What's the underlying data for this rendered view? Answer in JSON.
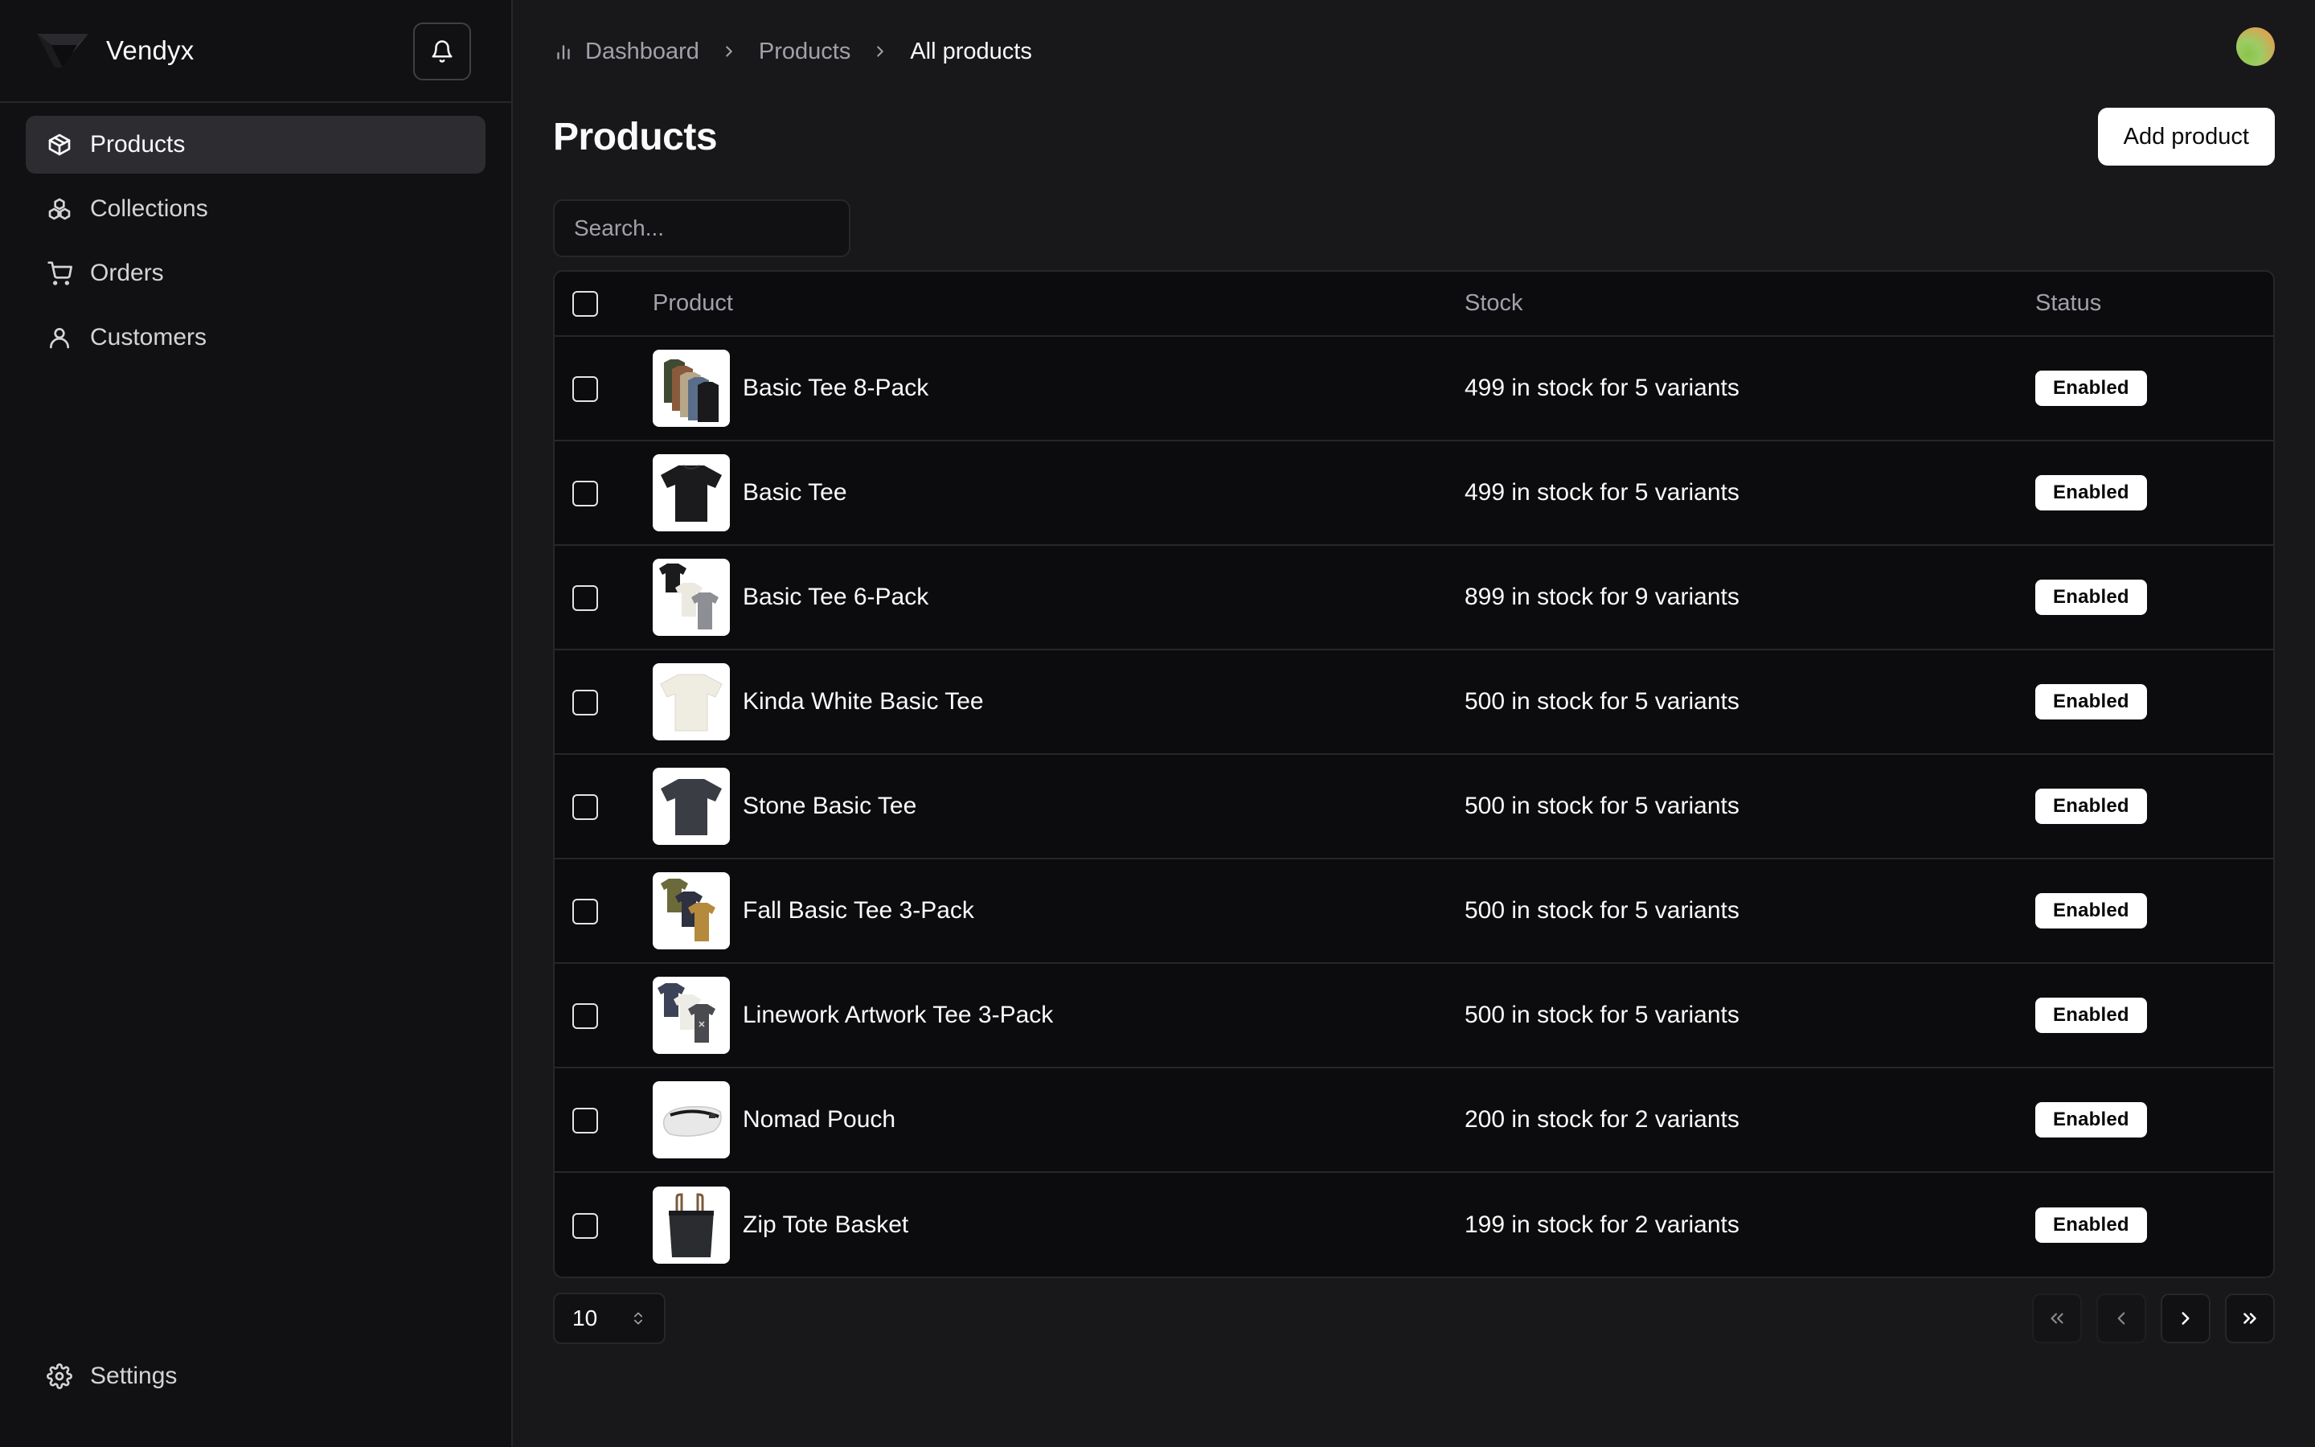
{
  "app": {
    "brand": "Vendyx"
  },
  "sidebar": {
    "items": [
      {
        "label": "Products",
        "icon": "package-icon",
        "active": true
      },
      {
        "label": "Collections",
        "icon": "collections-icon",
        "active": false
      },
      {
        "label": "Orders",
        "icon": "cart-icon",
        "active": false
      },
      {
        "label": "Customers",
        "icon": "user-icon",
        "active": false
      }
    ],
    "settings_label": "Settings"
  },
  "breadcrumb": {
    "items": [
      "Dashboard",
      "Products",
      "All products"
    ]
  },
  "page": {
    "title": "Products",
    "add_button_label": "Add product"
  },
  "search": {
    "placeholder": "Search...",
    "value": ""
  },
  "table": {
    "columns": [
      "Product",
      "Stock",
      "Status"
    ],
    "rows": [
      {
        "name": "Basic Tee 8-Pack",
        "stock": "499 in stock for 5 variants",
        "status": "Enabled",
        "thumb": "tee-8pack"
      },
      {
        "name": "Basic Tee",
        "stock": "499 in stock for 5 variants",
        "status": "Enabled",
        "thumb": "tee-black"
      },
      {
        "name": "Basic Tee 6-Pack",
        "stock": "899 in stock for 9 variants",
        "status": "Enabled",
        "thumb": "tee-6pack"
      },
      {
        "name": "Kinda White Basic Tee",
        "stock": "500 in stock for 5 variants",
        "status": "Enabled",
        "thumb": "tee-white"
      },
      {
        "name": "Stone Basic Tee",
        "stock": "500 in stock for 5 variants",
        "status": "Enabled",
        "thumb": "tee-stone"
      },
      {
        "name": "Fall Basic Tee 3-Pack",
        "stock": "500 in stock for 5 variants",
        "status": "Enabled",
        "thumb": "tee-fall"
      },
      {
        "name": "Linework Artwork Tee 3-Pack",
        "stock": "500 in stock for 5 variants",
        "status": "Enabled",
        "thumb": "tee-linework"
      },
      {
        "name": "Nomad Pouch",
        "stock": "200 in stock for 2 variants",
        "status": "Enabled",
        "thumb": "pouch"
      },
      {
        "name": "Zip Tote Basket",
        "stock": "199 in stock for 2 variants",
        "status": "Enabled",
        "thumb": "tote"
      }
    ]
  },
  "pagination": {
    "page_size": "10"
  },
  "colors": {
    "background": "#18181b",
    "sidebar": "#111113",
    "border": "#27272a",
    "accent": "#ffffff"
  }
}
